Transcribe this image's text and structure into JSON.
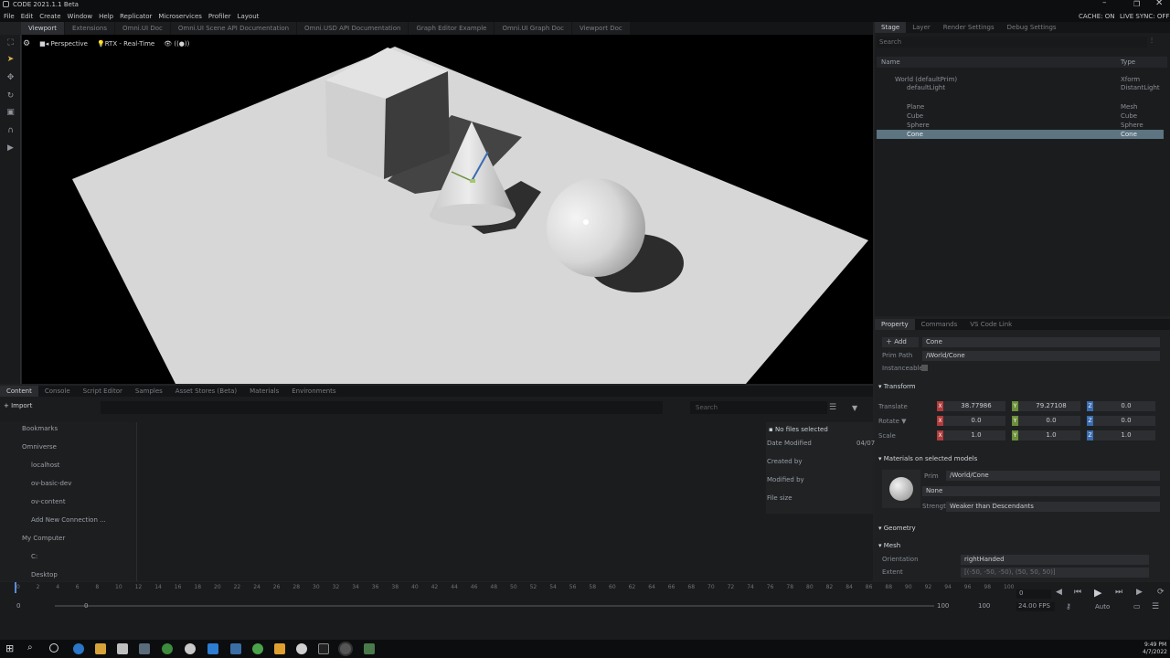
{
  "titlebar": {
    "title": "CODE 2021.1.1 Beta",
    "cache": "CACHE: ON",
    "live_sync": "LIVE SYNC: OFF"
  },
  "menu": [
    "File",
    "Edit",
    "Create",
    "Window",
    "Help",
    "Replicator",
    "Microservices",
    "Profiler",
    "Layout"
  ],
  "viewport_tabs": [
    "Viewport",
    "Extensions",
    "Omni.UI Doc",
    "Omni.UI Scene API Documentation",
    "Omni.USD API Documentation",
    "Graph Editor Example",
    "Omni.UI Graph Doc",
    "Viewport Doc"
  ],
  "viewport_toolbar": {
    "camera": "Perspective",
    "renderer": "RTX - Real-Time",
    "extra": "((●))"
  },
  "stage": {
    "tabs": [
      "Stage",
      "Layer",
      "Render Settings",
      "Debug Settings"
    ],
    "search_placeholder": "Search",
    "col_name": "Name",
    "col_type": "Type",
    "items": [
      {
        "name": "World (defaultPrim)",
        "type": "Xform"
      },
      {
        "name": "defaultLight",
        "type": "DistantLight"
      },
      {
        "name": "Plane",
        "type": "Mesh"
      },
      {
        "name": "Cube",
        "type": "Cube"
      },
      {
        "name": "Sphere",
        "type": "Sphere"
      },
      {
        "name": "Cone",
        "type": "Cone"
      }
    ]
  },
  "property": {
    "tabs": [
      "Property",
      "Commands",
      "VS Code Link"
    ],
    "add_label": "Add",
    "prim_name": "Cone",
    "prim_path_label": "Prim Path",
    "prim_path": "/World/Cone",
    "instanceable_label": "Instanceable",
    "transform_header": "Transform",
    "translate_label": "Translate",
    "rotate_label": "Rotate ▼",
    "scale_label": "Scale",
    "translate": [
      "38.77986",
      "79.27108",
      "0.0"
    ],
    "rotate": [
      "0.0",
      "0.0",
      "0.0"
    ],
    "scale": [
      "1.0",
      "1.0",
      "1.0"
    ],
    "materials_header": "Materials on selected models",
    "mat_prim_label": "Prim",
    "mat_prim": "/World/Cone",
    "mat_value": "None",
    "strength_label": "Strength",
    "strength": "Weaker than Descendants",
    "geometry_header": "Geometry",
    "mesh_header": "Mesh",
    "orientation_label": "Orientation",
    "orientation": "rightHanded",
    "extent_label": "Extent",
    "extent": "[(-50, -50, -50), (50, 50, 50)]"
  },
  "bottom": {
    "tabs": [
      "Content",
      "Console",
      "Script Editor",
      "Samples",
      "Asset Stores (Beta)",
      "Materials",
      "Environments"
    ],
    "import_label": "Import",
    "search_placeholder": "Search",
    "tree": [
      "Bookmarks",
      "Omniverse",
      "localhost",
      "ov-basic-dev",
      "ov-content",
      "Add New Connection ...",
      "My Computer",
      "C:",
      "Desktop"
    ],
    "no_files": "No files selected",
    "date_modified_label": "Date Modified",
    "date_modified": "04/07",
    "created_by_label": "Created by",
    "modified_by_label": "Modified by",
    "file_size_label": "File size"
  },
  "timeline": {
    "ticks": [
      "0",
      "2",
      "4",
      "6",
      "8",
      "10",
      "12",
      "14",
      "16",
      "18",
      "20",
      "22",
      "24",
      "26",
      "28",
      "30",
      "32",
      "34",
      "36",
      "38",
      "40",
      "42",
      "44",
      "46",
      "48",
      "50",
      "52",
      "54",
      "56",
      "58",
      "60",
      "62",
      "64",
      "66",
      "68",
      "70",
      "72",
      "74",
      "76",
      "78",
      "80",
      "82",
      "84",
      "86",
      "88",
      "90",
      "92",
      "94",
      "96",
      "98",
      "100"
    ],
    "start": "0",
    "range_start": "0",
    "range_end": "100",
    "end": "100",
    "current_frame": "0",
    "fps": "24.00 FPS",
    "mode": "Auto"
  },
  "taskbar": {
    "time": "9:49 PM",
    "date": "4/7/2022"
  },
  "colors": {
    "accent": "#5d7481",
    "selection": "#5d7481",
    "x_axis": "#b23b3b",
    "y_axis": "#6d8f3a",
    "z_axis": "#3a6cb2"
  }
}
